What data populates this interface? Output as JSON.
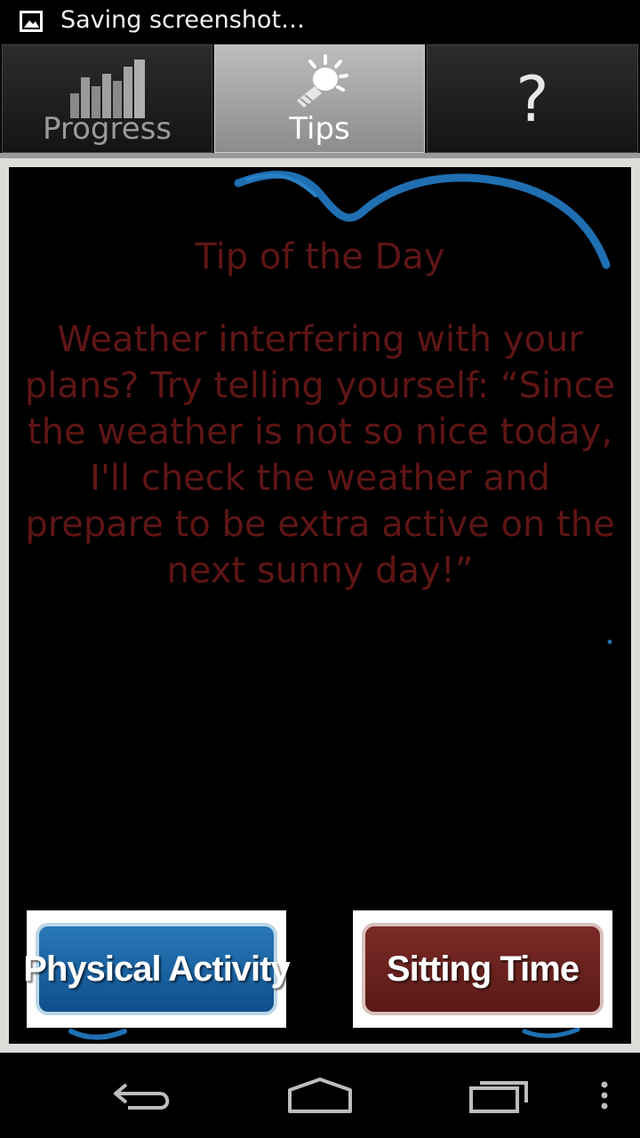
{
  "status_bar": {
    "notification": "Saving screenshot…"
  },
  "tabs": [
    {
      "label": "Progress",
      "icon": "bar-chart-icon",
      "active": false
    },
    {
      "label": "Tips",
      "icon": "lightbulb-icon",
      "active": true
    },
    {
      "label": "?",
      "icon": "help-icon",
      "active": false
    }
  ],
  "tip": {
    "title": "Tip of the Day",
    "body": "Weather interfering with your plans? Try telling yourself: “Since the weather is not so nice today, I'll check the weather and prepare to be extra active on the next sunny day!”"
  },
  "buttons": {
    "physical_activity": "Physical Activity",
    "sitting_time": "Sitting Time"
  },
  "colors": {
    "tip_text": "#5f1515",
    "swoosh": "#1f6fb2",
    "physical_activity_button": "#0e4f8c",
    "sitting_time_button": "#6a211d"
  },
  "nav_bar": {
    "icons": [
      "back-icon",
      "home-icon",
      "recent-apps-icon",
      "overflow-menu-icon"
    ]
  }
}
